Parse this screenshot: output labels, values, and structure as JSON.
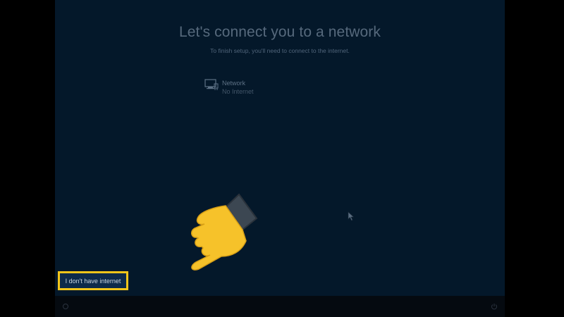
{
  "setup": {
    "title": "Let's connect you to a network",
    "subtitle": "To finish setup, you'll need to connect to the internet.",
    "network": {
      "name": "Network",
      "status": "No Internet",
      "icon": "ethernet-network-icon"
    },
    "no_internet_button": "I don't have internet"
  },
  "annotation": {
    "pointer_icon": "pointing-hand-icon",
    "highlight_color": "#f2c51a"
  },
  "taskbar": {
    "left_icon": "ease-of-access-icon",
    "right_icon": "power-icon"
  },
  "colors": {
    "background": "#04182a",
    "letterbox": "#000000"
  }
}
